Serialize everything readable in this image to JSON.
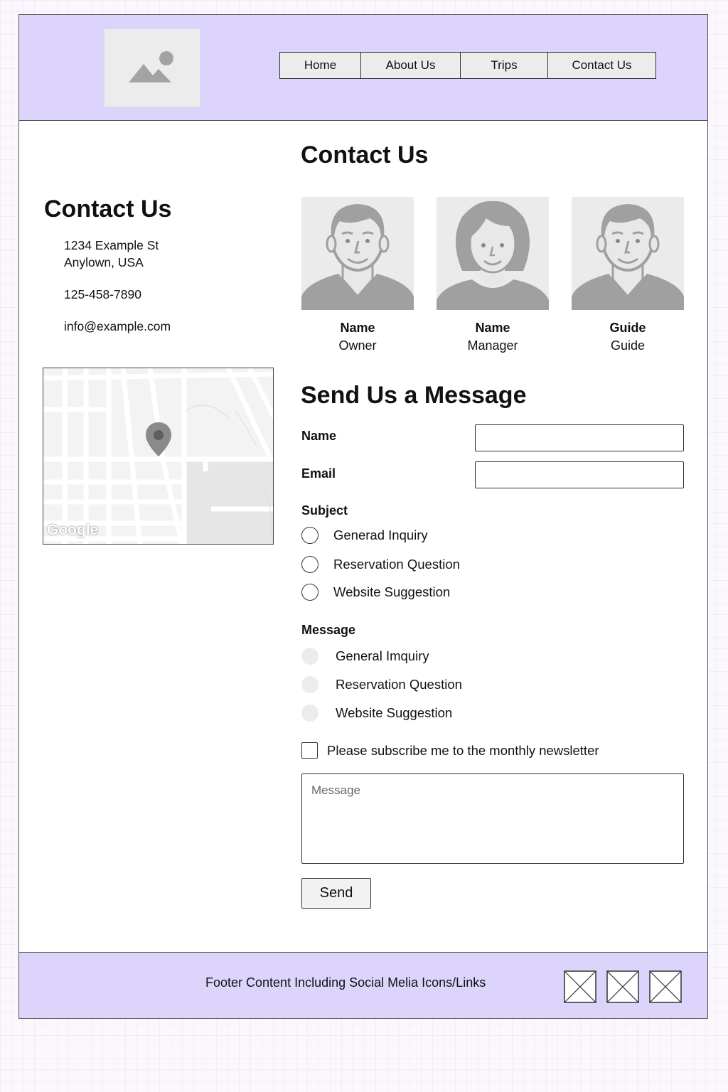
{
  "header": {
    "logo_icon": "image-placeholder-icon",
    "nav": [
      {
        "label": "Home"
      },
      {
        "label": "About Us"
      },
      {
        "label": "Trips"
      },
      {
        "label": "Contact Us"
      }
    ]
  },
  "sidebar": {
    "title": "Contact Us",
    "address_line1": "1234 Example St",
    "address_line2": "Anylown, USA",
    "phone": "125-458-7890",
    "email": "info@example.com",
    "map_icon": "map-pin-icon",
    "map_watermark": "Google"
  },
  "main": {
    "title": "Contact Us",
    "team": [
      {
        "name": "Name",
        "role": "Owner",
        "avatar": "male-avatar-icon"
      },
      {
        "name": "Name",
        "role": "Manager",
        "avatar": "female-avatar-icon"
      },
      {
        "name": "Guide",
        "role": "Guide",
        "avatar": "male-avatar-icon"
      }
    ]
  },
  "form": {
    "title": "Send Us a Message",
    "name_label": "Name",
    "email_label": "Email",
    "subject_label": "Subject",
    "subject_options": [
      "Generad Inquiry",
      "Reservation Question",
      "Website Suggestion"
    ],
    "message_label": "Message",
    "message_options": [
      "General Imquiry",
      "Reservation Question",
      "Website Suggestion"
    ],
    "newsletter_label": "Please subscribe me to the monthly newsletter",
    "message_placeholder": "Message",
    "send_label": "Send"
  },
  "footer": {
    "text": "Footer Content Including Social Melia Icons/Links",
    "social_icons": [
      "social-placeholder-icon",
      "social-placeholder-icon",
      "social-placeholder-icon"
    ]
  },
  "colors": {
    "header_bg": "#dcd4fb",
    "footer_bg": "#dcd4fb",
    "placeholder_gray": "#9e9e9e"
  }
}
